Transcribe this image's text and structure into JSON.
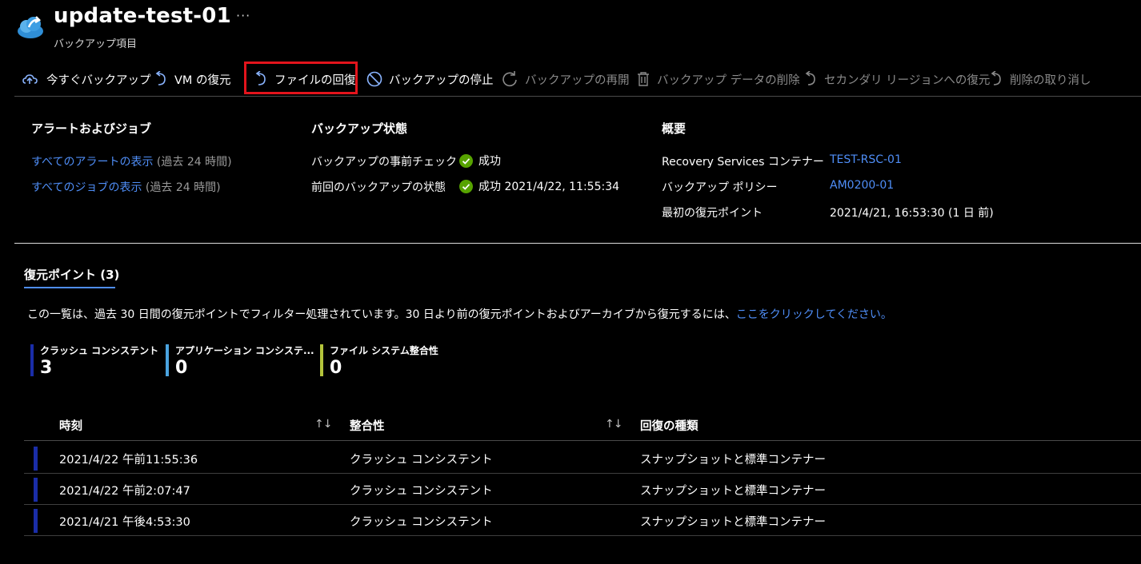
{
  "header": {
    "title": "update-test-01",
    "subtitle": "バックアップ項目",
    "more": "···"
  },
  "toolbar": [
    {
      "label": "今すぐバックアップ",
      "icon": "backup-cloud-icon",
      "enabled": true
    },
    {
      "label": "VM の復元",
      "icon": "undo-icon",
      "enabled": true
    },
    {
      "label": "ファイルの回復",
      "icon": "undo-icon",
      "enabled": true,
      "highlighted": true
    },
    {
      "label": "バックアップの停止",
      "icon": "block-icon",
      "enabled": true
    },
    {
      "label": "バックアップの再開",
      "icon": "refresh-icon",
      "enabled": false
    },
    {
      "label": "バックアップ データの削除",
      "icon": "trash-icon",
      "enabled": false
    },
    {
      "label": "セカンダリ リージョンへの復元",
      "icon": "undo-icon",
      "enabled": false
    },
    {
      "label": "削除の取り消し",
      "icon": "undo-icon",
      "enabled": false
    }
  ],
  "alerts": {
    "heading": "アラートおよびジョブ",
    "all_alerts_link": "すべてのアラートの表示",
    "all_alerts_note": "(過去 24 時間)",
    "all_jobs_link": "すべてのジョブの表示",
    "all_jobs_note": "(過去 24 時間)"
  },
  "backup_status": {
    "heading": "バックアップ状態",
    "precheck_label": "バックアップの事前チェック",
    "precheck_value": "成功",
    "last_backup_label": "前回のバックアップの状態",
    "last_backup_value": "成功 2021/4/22, 11:55:34"
  },
  "summary": {
    "heading": "概要",
    "vault_label": "Recovery Services コンテナー",
    "vault_value": "TEST-RSC-01",
    "policy_label": "バックアップ ポリシー",
    "policy_value": "AM0200-01",
    "first_point_label": "最初の復元ポイント",
    "first_point_value": "2021/4/21, 16:53:30 (1 日 前)"
  },
  "restore_points": {
    "tab_label": "復元ポイント (3)",
    "info_text": "この一覧は、過去 30 日間の復元ポイントでフィルター処理されています。30 日より前の復元ポイントおよびアーカイブから復元するには、",
    "info_link": "ここをクリックしてください。",
    "counters": [
      {
        "label": "クラッシュ コンシステント",
        "value": "3",
        "color": "#1a2da8"
      },
      {
        "label": "アプリケーション コンシステ...",
        "value": "0",
        "color": "#4aa3df"
      },
      {
        "label": "ファイル システム整合性",
        "value": "0",
        "color": "#b4c43b"
      }
    ],
    "columns": [
      "時刻",
      "整合性",
      "回復の種類"
    ],
    "rows": [
      {
        "time": "2021/4/22 午前11:55:36",
        "consistency": "クラッシュ コンシステント",
        "type": "スナップショットと標準コンテナー"
      },
      {
        "time": "2021/4/22 午前2:07:47",
        "consistency": "クラッシュ コンシステント",
        "type": "スナップショットと標準コンテナー"
      },
      {
        "time": "2021/4/21 午後4:53:30",
        "consistency": "クラッシュ コンシステント",
        "type": "スナップショットと標準コンテナー"
      }
    ]
  }
}
